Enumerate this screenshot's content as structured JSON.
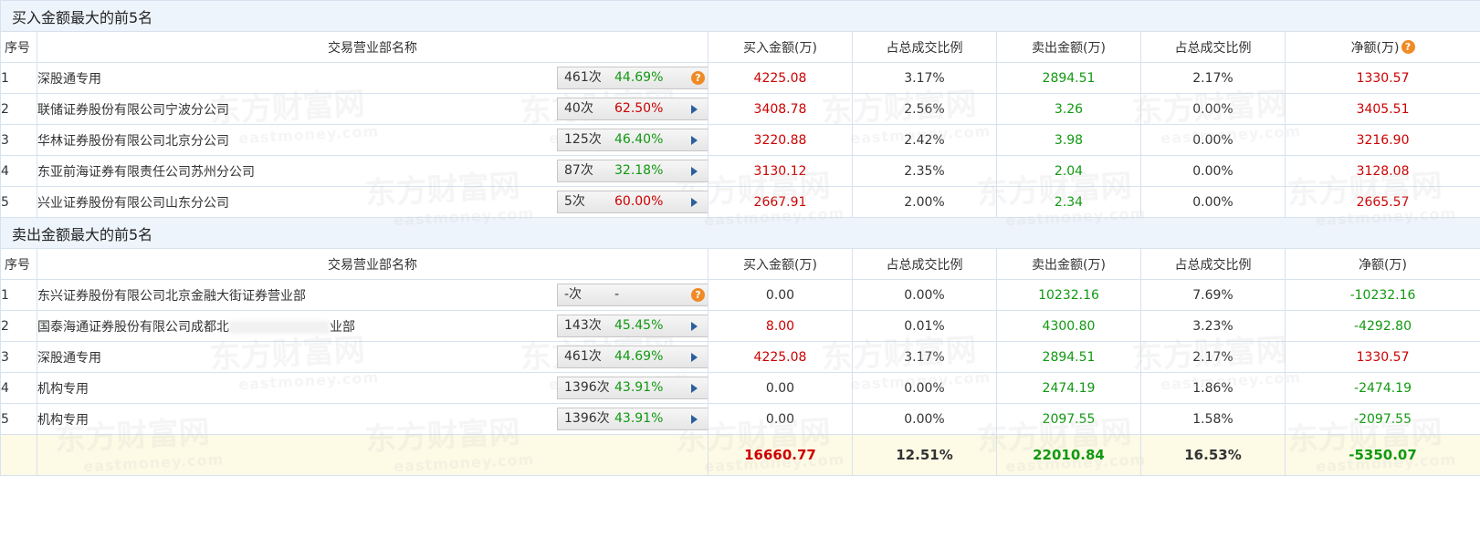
{
  "buy_section": {
    "title": "买入金额最大的前5名",
    "headers": {
      "idx": "序号",
      "name": "交易营业部名称",
      "buy": "买入金额(万)",
      "buy_ratio": "占总成交比例",
      "sell": "卖出金额(万)",
      "sell_ratio": "占总成交比例",
      "net": "净额(万)"
    },
    "rows": [
      {
        "idx": "1",
        "name": "深股通专用",
        "count": "461次",
        "rate": "44.69%",
        "rate_color": "green",
        "action": "help",
        "buy": "4225.08",
        "buy_ratio": "3.17%",
        "sell": "2894.51",
        "sell_ratio": "2.17%",
        "net": "1330.57",
        "net_color": "red"
      },
      {
        "idx": "2",
        "name": "联储证券股份有限公司宁波分公司",
        "count": "40次",
        "rate": "62.50%",
        "rate_color": "red",
        "action": "arrow",
        "buy": "3408.78",
        "buy_ratio": "2.56%",
        "sell": "3.26",
        "sell_ratio": "0.00%",
        "net": "3405.51",
        "net_color": "red"
      },
      {
        "idx": "3",
        "name": "华林证券股份有限公司北京分公司",
        "count": "125次",
        "rate": "46.40%",
        "rate_color": "green",
        "action": "arrow",
        "buy": "3220.88",
        "buy_ratio": "2.42%",
        "sell": "3.98",
        "sell_ratio": "0.00%",
        "net": "3216.90",
        "net_color": "red"
      },
      {
        "idx": "4",
        "name": "东亚前海证券有限责任公司苏州分公司",
        "count": "87次",
        "rate": "32.18%",
        "rate_color": "green",
        "action": "arrow",
        "buy": "3130.12",
        "buy_ratio": "2.35%",
        "sell": "2.04",
        "sell_ratio": "0.00%",
        "net": "3128.08",
        "net_color": "red"
      },
      {
        "idx": "5",
        "name": "兴业证券股份有限公司山东分公司",
        "count": "5次",
        "rate": "60.00%",
        "rate_color": "red",
        "action": "arrow",
        "buy": "2667.91",
        "buy_ratio": "2.00%",
        "sell": "2.34",
        "sell_ratio": "0.00%",
        "net": "2665.57",
        "net_color": "red"
      }
    ]
  },
  "sell_section": {
    "title": "卖出金额最大的前5名",
    "headers": {
      "idx": "序号",
      "name": "交易营业部名称",
      "buy": "买入金额(万)",
      "buy_ratio": "占总成交比例",
      "sell": "卖出金额(万)",
      "sell_ratio": "占总成交比例",
      "net": "净额(万)"
    },
    "rows": [
      {
        "idx": "1",
        "name": "东兴证券股份有限公司北京金融大街证券营业部",
        "count": "-次",
        "rate": "-",
        "rate_color": "gray",
        "action": "help",
        "buy": "0.00",
        "buy_color": "black",
        "buy_ratio": "0.00%",
        "sell": "10232.16",
        "sell_ratio": "7.69%",
        "net": "-10232.16",
        "net_color": "green"
      },
      {
        "idx": "2",
        "name": "国泰海通证券股份有限公司成都北",
        "name_tail": "业部",
        "count": "143次",
        "rate": "45.45%",
        "rate_color": "green",
        "action": "arrow",
        "buy": "8.00",
        "buy_color": "red",
        "buy_ratio": "0.01%",
        "sell": "4300.80",
        "sell_ratio": "3.23%",
        "net": "-4292.80",
        "net_color": "green"
      },
      {
        "idx": "3",
        "name": "深股通专用",
        "count": "461次",
        "rate": "44.69%",
        "rate_color": "green",
        "action": "arrow",
        "buy": "4225.08",
        "buy_color": "red",
        "buy_ratio": "3.17%",
        "sell": "2894.51",
        "sell_ratio": "2.17%",
        "net": "1330.57",
        "net_color": "red"
      },
      {
        "idx": "4",
        "name": "机构专用",
        "count": "1396次",
        "rate": "43.91%",
        "rate_color": "green",
        "action": "arrow",
        "buy": "0.00",
        "buy_color": "black",
        "buy_ratio": "0.00%",
        "sell": "2474.19",
        "sell_ratio": "1.86%",
        "net": "-2474.19",
        "net_color": "green"
      },
      {
        "idx": "5",
        "name": "机构专用",
        "count": "1396次",
        "rate": "43.91%",
        "rate_color": "green",
        "action": "arrow",
        "buy": "0.00",
        "buy_color": "black",
        "buy_ratio": "0.00%",
        "sell": "2097.55",
        "sell_ratio": "1.58%",
        "net": "-2097.55",
        "net_color": "green"
      }
    ]
  },
  "totals": {
    "buy": "16660.77",
    "buy_ratio": "12.51%",
    "sell": "22010.84",
    "sell_ratio": "16.53%",
    "net": "-5350.07"
  },
  "watermark": {
    "text": "东方财富网",
    "sub": "eastmoney.com"
  },
  "colors": {
    "red": "#cc0000",
    "green": "#119911",
    "header_bg": "#eef4fb",
    "total_bg": "#fdfae6",
    "help": "#f08a24",
    "arrow": "#2a5f9e"
  }
}
